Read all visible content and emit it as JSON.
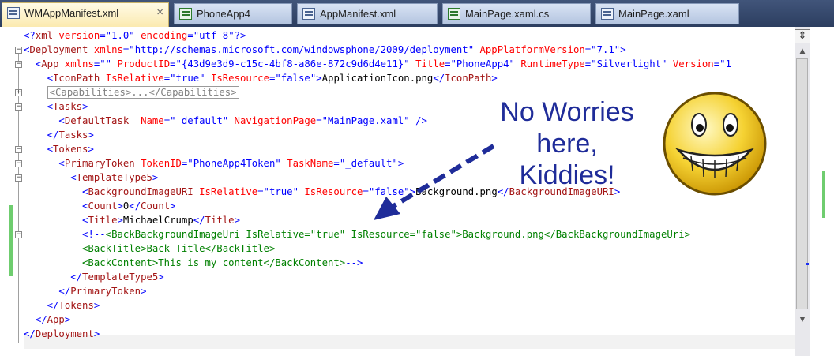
{
  "tabs": [
    {
      "label": "WMAppManifest.xml",
      "active": true,
      "icon": "xml-file-icon"
    },
    {
      "label": "PhoneApp4",
      "active": false,
      "icon": "project-properties-icon"
    },
    {
      "label": "AppManifest.xml",
      "active": false,
      "icon": "xml-file-icon"
    },
    {
      "label": "MainPage.xaml.cs",
      "active": false,
      "icon": "cs-file-icon"
    },
    {
      "label": "MainPage.xaml",
      "active": false,
      "icon": "xaml-file-icon"
    }
  ],
  "tab_close_glyph": "×",
  "code_lines": [
    [
      [
        "b",
        "<?"
      ],
      [
        "t",
        "xml"
      ],
      [
        "a",
        " version"
      ],
      [
        "b",
        "=\""
      ],
      [
        "v",
        "1.0"
      ],
      [
        "b",
        "\""
      ],
      [
        "a",
        " encoding"
      ],
      [
        "b",
        "=\""
      ],
      [
        "v",
        "utf-8"
      ],
      [
        "b",
        "\"?>"
      ]
    ],
    [
      [
        "b",
        "<"
      ],
      [
        "t",
        "Deployment"
      ],
      [
        "a",
        " xmlns"
      ],
      [
        "b",
        "=\""
      ],
      [
        "u",
        "http://schemas.microsoft.com/windowsphone/2009/deployment"
      ],
      [
        "b",
        "\""
      ],
      [
        "a",
        " AppPlatformVersion"
      ],
      [
        "b",
        "=\""
      ],
      [
        "v",
        "7.1"
      ],
      [
        "b",
        "\">"
      ]
    ],
    [
      [
        "x",
        "  "
      ],
      [
        "b",
        "<"
      ],
      [
        "t",
        "App"
      ],
      [
        "a",
        " xmlns"
      ],
      [
        "b",
        "=\"\""
      ],
      [
        "a",
        " ProductID"
      ],
      [
        "b",
        "=\""
      ],
      [
        "v",
        "{43d9e3d9-c15c-4bf8-a86e-872c9d6d4e11}"
      ],
      [
        "b",
        "\""
      ],
      [
        "a",
        " Title"
      ],
      [
        "b",
        "=\""
      ],
      [
        "v",
        "PhoneApp4"
      ],
      [
        "b",
        "\""
      ],
      [
        "a",
        " RuntimeType"
      ],
      [
        "b",
        "=\""
      ],
      [
        "v",
        "Silverlight"
      ],
      [
        "b",
        "\""
      ],
      [
        "a",
        " Version"
      ],
      [
        "b",
        "=\"1"
      ]
    ],
    [
      [
        "x",
        "    "
      ],
      [
        "b",
        "<"
      ],
      [
        "t",
        "IconPath"
      ],
      [
        "a",
        " IsRelative"
      ],
      [
        "b",
        "=\""
      ],
      [
        "v",
        "true"
      ],
      [
        "b",
        "\""
      ],
      [
        "a",
        " IsResource"
      ],
      [
        "b",
        "=\""
      ],
      [
        "v",
        "false"
      ],
      [
        "b",
        "\">"
      ],
      [
        "x",
        "ApplicationIcon.png"
      ],
      [
        "b",
        "</"
      ],
      [
        "t",
        "IconPath"
      ],
      [
        "b",
        ">"
      ]
    ],
    [
      [
        "x",
        "    "
      ],
      [
        "box",
        "<Capabilities>...</Capabilities>"
      ]
    ],
    [
      [
        "x",
        "    "
      ],
      [
        "b",
        "<"
      ],
      [
        "t",
        "Tasks"
      ],
      [
        "b",
        ">"
      ]
    ],
    [
      [
        "x",
        "      "
      ],
      [
        "b",
        "<"
      ],
      [
        "t",
        "DefaultTask"
      ],
      [
        "a",
        "  Name"
      ],
      [
        "b",
        "=\""
      ],
      [
        "v",
        "_default"
      ],
      [
        "b",
        "\""
      ],
      [
        "a",
        " NavigationPage"
      ],
      [
        "b",
        "=\""
      ],
      [
        "v",
        "MainPage.xaml"
      ],
      [
        "b",
        "\" />"
      ]
    ],
    [
      [
        "x",
        "    "
      ],
      [
        "b",
        "</"
      ],
      [
        "t",
        "Tasks"
      ],
      [
        "b",
        ">"
      ]
    ],
    [
      [
        "x",
        "    "
      ],
      [
        "b",
        "<"
      ],
      [
        "t",
        "Tokens"
      ],
      [
        "b",
        ">"
      ]
    ],
    [
      [
        "x",
        "      "
      ],
      [
        "b",
        "<"
      ],
      [
        "t",
        "PrimaryToken"
      ],
      [
        "a",
        " TokenID"
      ],
      [
        "b",
        "=\""
      ],
      [
        "v",
        "PhoneApp4Token"
      ],
      [
        "b",
        "\""
      ],
      [
        "a",
        " TaskName"
      ],
      [
        "b",
        "=\""
      ],
      [
        "v",
        "_default"
      ],
      [
        "b",
        "\">"
      ]
    ],
    [
      [
        "x",
        "        "
      ],
      [
        "b",
        "<"
      ],
      [
        "t",
        "TemplateType5"
      ],
      [
        "b",
        ">"
      ]
    ],
    [
      [
        "x",
        "          "
      ],
      [
        "b",
        "<"
      ],
      [
        "t",
        "BackgroundImageURI"
      ],
      [
        "a",
        " IsRelative"
      ],
      [
        "b",
        "=\""
      ],
      [
        "v",
        "true"
      ],
      [
        "b",
        "\""
      ],
      [
        "a",
        " IsResource"
      ],
      [
        "b",
        "=\""
      ],
      [
        "v",
        "false"
      ],
      [
        "b",
        "\">"
      ],
      [
        "x",
        "Background.png"
      ],
      [
        "b",
        "</"
      ],
      [
        "t",
        "BackgroundImageURI"
      ],
      [
        "b",
        ">"
      ]
    ],
    [
      [
        "x",
        "          "
      ],
      [
        "b",
        "<"
      ],
      [
        "t",
        "Count"
      ],
      [
        "b",
        ">"
      ],
      [
        "x",
        "0"
      ],
      [
        "b",
        "</"
      ],
      [
        "t",
        "Count"
      ],
      [
        "b",
        ">"
      ]
    ],
    [
      [
        "x",
        "          "
      ],
      [
        "b",
        "<"
      ],
      [
        "t",
        "Title"
      ],
      [
        "b",
        ">"
      ],
      [
        "x",
        "MichaelCrump"
      ],
      [
        "b",
        "</"
      ],
      [
        "t",
        "Title"
      ],
      [
        "b",
        ">"
      ]
    ],
    [
      [
        "x",
        "          "
      ],
      [
        "b",
        "<!--"
      ],
      [
        "c",
        "<BackBackgroundImageUri IsRelative=\"true\" IsResource=\"false\">Background.png</BackBackgroundImageUri>"
      ]
    ],
    [
      [
        "c",
        "          <BackTitle>Back Title</BackTitle>"
      ]
    ],
    [
      [
        "c",
        "          <BackContent>This is my content</BackContent>"
      ],
      [
        "b",
        "-->"
      ]
    ],
    [
      [
        "x",
        "        "
      ],
      [
        "b",
        "</"
      ],
      [
        "t",
        "TemplateType5"
      ],
      [
        "b",
        ">"
      ]
    ],
    [
      [
        "x",
        "      "
      ],
      [
        "b",
        "</"
      ],
      [
        "t",
        "PrimaryToken"
      ],
      [
        "b",
        ">"
      ]
    ],
    [
      [
        "x",
        "    "
      ],
      [
        "b",
        "</"
      ],
      [
        "t",
        "Tokens"
      ],
      [
        "b",
        ">"
      ]
    ],
    [
      [
        "x",
        "  "
      ],
      [
        "b",
        "</"
      ],
      [
        "t",
        "App"
      ],
      [
        "b",
        ">"
      ]
    ],
    [
      [
        "b",
        "</"
      ],
      [
        "t",
        "Deployment"
      ],
      [
        "b",
        ">"
      ]
    ]
  ],
  "fold_markers": [
    {
      "line": 1,
      "glyph": "−"
    },
    {
      "line": 2,
      "glyph": "−"
    },
    {
      "line": 4,
      "glyph": "+"
    },
    {
      "line": 5,
      "glyph": "−"
    },
    {
      "line": 8,
      "glyph": "−"
    },
    {
      "line": 9,
      "glyph": "−"
    },
    {
      "line": 10,
      "glyph": "−"
    },
    {
      "line": 14,
      "glyph": "−"
    }
  ],
  "scrollbar": {
    "split_glyph": "⇕",
    "up_glyph": "▲",
    "down_glyph": "▼"
  },
  "annotation": {
    "lines": [
      "No Worries",
      "here,",
      "Kiddies!"
    ],
    "color": "#1f2c99"
  },
  "colors": {
    "tag": "#a31515",
    "attr": "#ff0000",
    "value": "#0000ff",
    "comment": "#008000",
    "change_bar": "#6fcd6f"
  }
}
